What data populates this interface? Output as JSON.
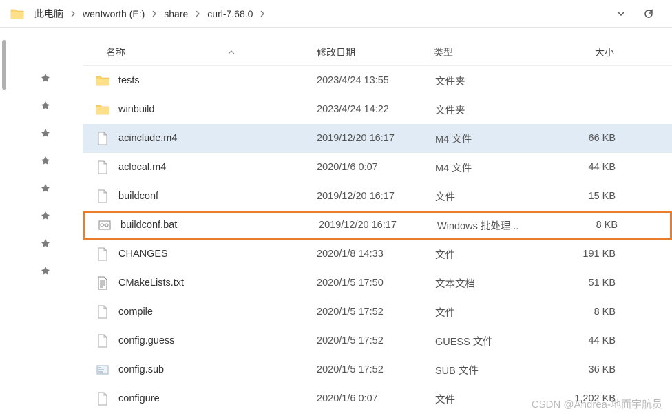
{
  "breadcrumbs": [
    {
      "label": "此电脑"
    },
    {
      "label": "wentworth (E:)"
    },
    {
      "label": "share"
    },
    {
      "label": "curl-7.68.0"
    }
  ],
  "columns": {
    "name": "名称",
    "date": "修改日期",
    "type": "类型",
    "size": "大小"
  },
  "files": [
    {
      "icon": "folder",
      "name": "tests",
      "date": "2023/4/24 13:55",
      "type": "文件夹",
      "size": ""
    },
    {
      "icon": "folder",
      "name": "winbuild",
      "date": "2023/4/24 14:22",
      "type": "文件夹",
      "size": ""
    },
    {
      "icon": "file",
      "name": "acinclude.m4",
      "date": "2019/12/20 16:17",
      "type": "M4 文件",
      "size": "66 KB",
      "selected": true
    },
    {
      "icon": "file",
      "name": "aclocal.m4",
      "date": "2020/1/6 0:07",
      "type": "M4 文件",
      "size": "44 KB"
    },
    {
      "icon": "file",
      "name": "buildconf",
      "date": "2019/12/20 16:17",
      "type": "文件",
      "size": "15 KB"
    },
    {
      "icon": "bat",
      "name": "buildconf.bat",
      "date": "2019/12/20 16:17",
      "type": "Windows 批处理...",
      "size": "8 KB",
      "highlighted": true
    },
    {
      "icon": "file",
      "name": "CHANGES",
      "date": "2020/1/8 14:33",
      "type": "文件",
      "size": "191 KB"
    },
    {
      "icon": "text",
      "name": "CMakeLists.txt",
      "date": "2020/1/5 17:50",
      "type": "文本文档",
      "size": "51 KB"
    },
    {
      "icon": "file",
      "name": "compile",
      "date": "2020/1/5 17:52",
      "type": "文件",
      "size": "8 KB"
    },
    {
      "icon": "file",
      "name": "config.guess",
      "date": "2020/1/5 17:52",
      "type": "GUESS 文件",
      "size": "44 KB"
    },
    {
      "icon": "sub",
      "name": "config.sub",
      "date": "2020/1/5 17:52",
      "type": "SUB 文件",
      "size": "36 KB"
    },
    {
      "icon": "file",
      "name": "configure",
      "date": "2020/1/6 0:07",
      "type": "文件",
      "size": "1,202 KB"
    }
  ],
  "watermark": "CSDN @Andrea-地面宇航员"
}
